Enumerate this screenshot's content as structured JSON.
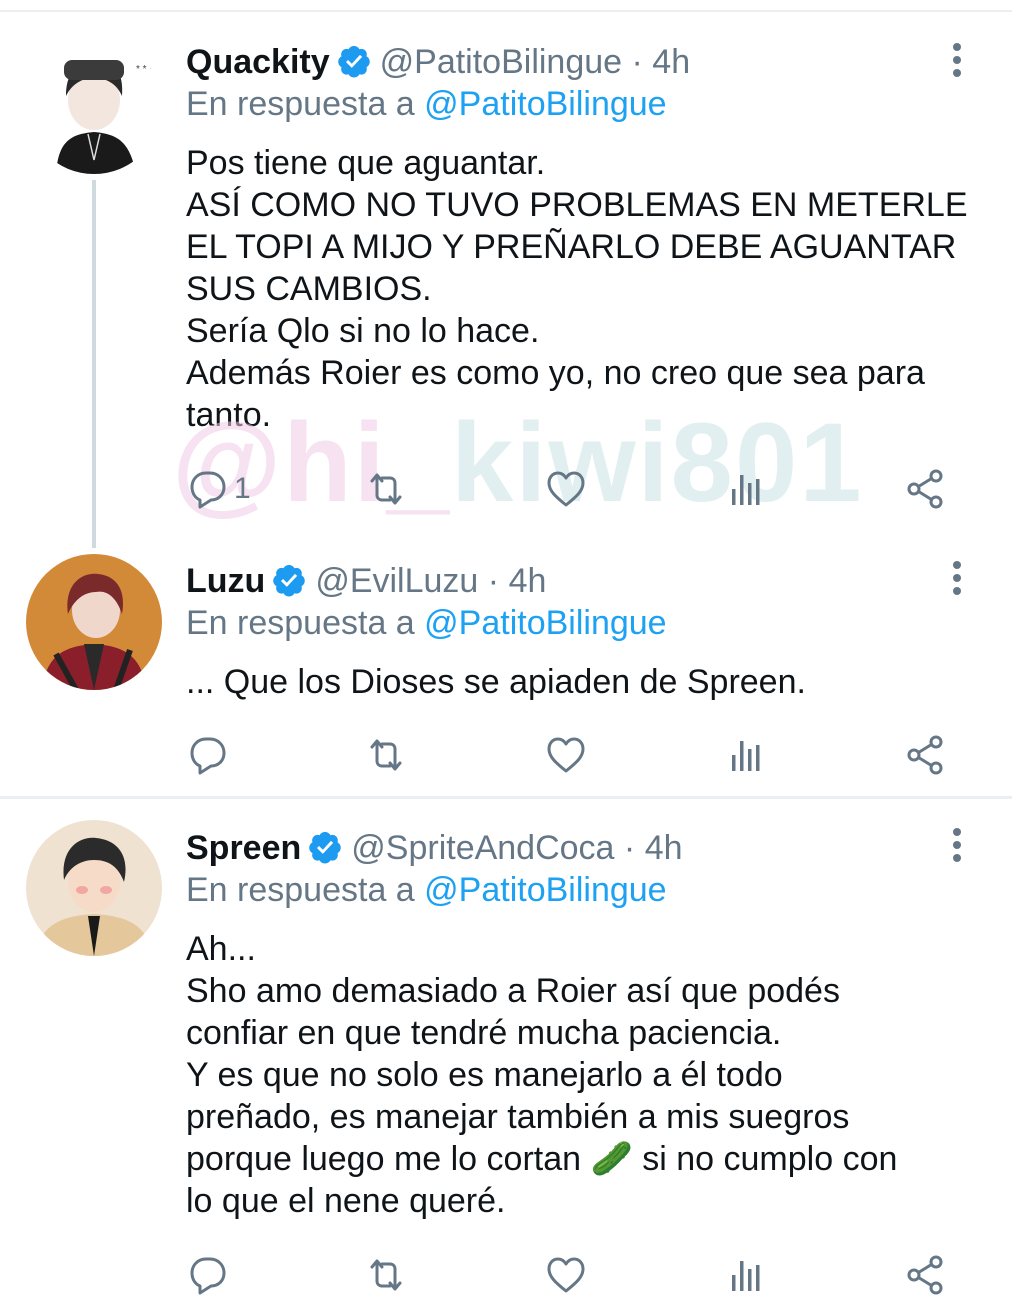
{
  "replying_prefix": "En respuesta a",
  "colors": {
    "accent": "#1da1f2",
    "secondary_text": "#657786",
    "verified": "#1d9bf0"
  },
  "watermark": {
    "part1": "@hi_",
    "part2": "kiwi801"
  },
  "tweets": [
    {
      "name": "Quackity",
      "handle": "@PatitoBilingue",
      "separator": "·",
      "time": "4h",
      "reply_to": "@PatitoBilingue",
      "lines": [
        "Pos tiene que aguantar.",
        "ASÍ COMO NO TUVO PROBLEMAS EN METERLE",
        "EL TOPI A MIJO Y PREÑARLO DEBE AGUANTAR",
        "SUS CAMBIOS.",
        "Sería Qlo si no lo hace.",
        "Además Roier es como yo, no creo que sea para",
        "tanto."
      ],
      "reply_count": "1"
    },
    {
      "name": "Luzu",
      "handle": "@EvilLuzu",
      "separator": "·",
      "time": "4h",
      "reply_to": "@PatitoBilingue",
      "lines": [
        "... Que los Dioses se apiaden de Spreen."
      ],
      "reply_count": ""
    },
    {
      "name": "Spreen",
      "handle": "@SpriteAndCoca",
      "separator": "·",
      "time": "4h",
      "reply_to": "@PatitoBilingue",
      "lines": [
        "Ah...",
        "Sho amo demasiado a Roier así que podés",
        "confiar en que tendré mucha paciencia.",
        "Y es que no solo es manejarlo a él todo",
        "preñado, es manejar también a mis suegros",
        "porque luego me lo cortan 🥒 si no cumplo con",
        "lo que el nene queré."
      ],
      "reply_count": ""
    }
  ]
}
